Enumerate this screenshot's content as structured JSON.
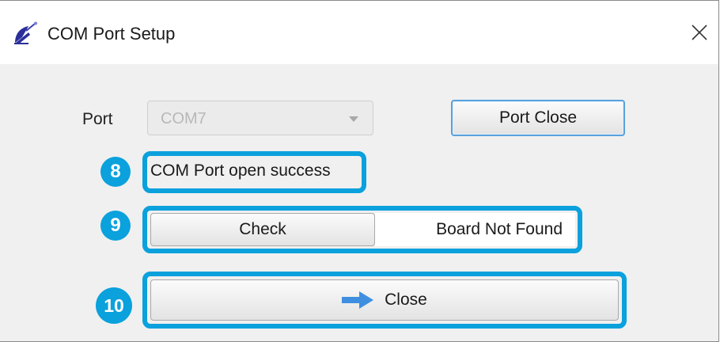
{
  "window": {
    "title": "COM Port Setup",
    "app_icon": "satellite-dish-icon",
    "close_icon": "close-icon"
  },
  "port": {
    "label": "Port",
    "selected_value": "COM7",
    "enabled": false
  },
  "buttons": {
    "port_close_label": "Port Close",
    "check_label": "Check",
    "close_label": "Close",
    "close_icon": "arrow-right-icon"
  },
  "status": {
    "com_port": "COM Port open success",
    "board": "Board Not Found"
  },
  "annotations": {
    "badges": [
      "8",
      "9",
      "10"
    ],
    "accent_color": "#0aa1dd"
  }
}
